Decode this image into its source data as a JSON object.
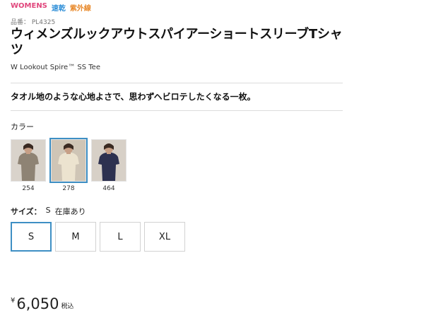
{
  "tags": {
    "womens": "WOMENS",
    "quick_dry": "速乾",
    "uv": "紫外線"
  },
  "product": {
    "number": "品番： PL4325",
    "title": "ウィメンズルックアウトスパイアーショートスリーブTシャツ",
    "subtitle": "W Lookout Spire™ SS Tee",
    "catchphrase": "タオル地のような心地よさで、思わずヘビロテしたくなる一枚。"
  },
  "color": {
    "label": "カラー",
    "options": [
      {
        "code": "254",
        "shirt_color": "#8e8374",
        "bg": "#d9d3cb",
        "selected": false
      },
      {
        "code": "278",
        "shirt_color": "#ece3cf",
        "bg": "#cfc5b6",
        "selected": true
      },
      {
        "code": "464",
        "shirt_color": "#2d3150",
        "bg": "#d7d0c7",
        "selected": false
      }
    ]
  },
  "size": {
    "label": "サイズ：",
    "selected": "S",
    "stock": "在庫あり",
    "options": [
      "S",
      "M",
      "L",
      "XL"
    ]
  },
  "price": {
    "currency": "¥",
    "amount": "6,050",
    "tax": "税込"
  },
  "colors": {
    "accent": "#3e8fc4",
    "womens": "#e0457b",
    "quick_dry": "#2f8fd8",
    "uv": "#e8892b"
  }
}
